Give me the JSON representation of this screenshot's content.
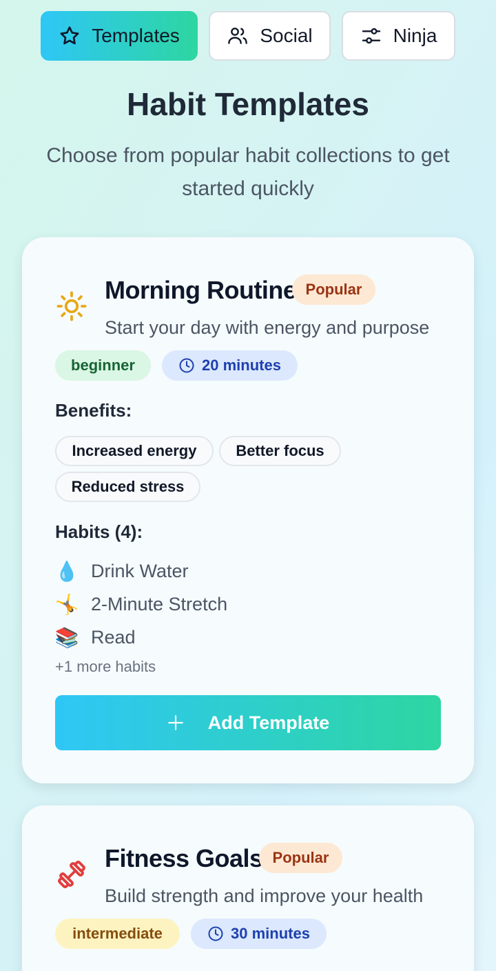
{
  "nav": {
    "tabs": [
      {
        "label": "Templates",
        "icon": "star-icon",
        "active": true
      },
      {
        "label": "Social",
        "icon": "users-icon",
        "active": false
      },
      {
        "label": "Ninja",
        "icon": "sliders-icon",
        "active": false
      }
    ]
  },
  "header": {
    "title": "Habit Templates",
    "subtitle": "Choose from popular habit collections to get started quickly"
  },
  "templates": [
    {
      "icon": "sun-icon",
      "title": "Morning Routine",
      "badge": "Popular",
      "description": "Start your day with energy and purpose",
      "difficulty": "beginner",
      "duration": "20 minutes",
      "benefits_label": "Benefits:",
      "benefits": [
        "Increased energy",
        "Better focus",
        "Reduced stress"
      ],
      "habits_label": "Habits (4):",
      "habits": [
        {
          "emoji": "💧",
          "label": "Drink Water"
        },
        {
          "emoji": "🤸",
          "label": "2-Minute Stretch"
        },
        {
          "emoji": "📚",
          "label": "Read"
        }
      ],
      "more_habits": "+1 more habits",
      "add_button": "Add Template"
    },
    {
      "icon": "dumbbell-icon",
      "title": "Fitness Goals",
      "badge": "Popular",
      "description": "Build strength and improve your health",
      "difficulty": "intermediate",
      "duration": "30 minutes"
    }
  ],
  "colors": {
    "accent_start": "#2ec7f6",
    "accent_end": "#2dd6a1",
    "popular_bg": "#fde8d3",
    "beginner_bg": "#daf6e4",
    "intermediate_bg": "#fdf3c0",
    "time_bg": "#dbe8fd"
  }
}
